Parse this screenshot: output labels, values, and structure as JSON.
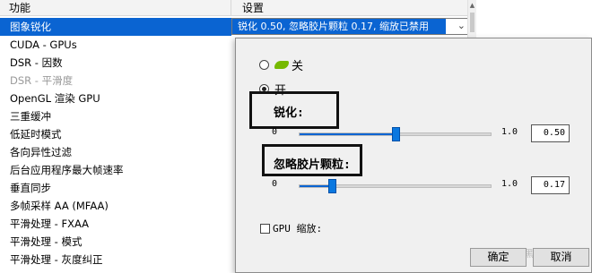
{
  "header": {
    "feature_col": "功能",
    "setting_col": "设置"
  },
  "features": [
    {
      "label": "图象锐化",
      "state": "selected"
    },
    {
      "label": "CUDA - GPUs",
      "state": "normal"
    },
    {
      "label": "DSR - 因数",
      "state": "normal"
    },
    {
      "label": "DSR - 平滑度",
      "state": "disabled"
    },
    {
      "label": "OpenGL 渲染 GPU",
      "state": "normal"
    },
    {
      "label": "三重缓冲",
      "state": "normal"
    },
    {
      "label": "低延时模式",
      "state": "normal"
    },
    {
      "label": "各向异性过滤",
      "state": "normal"
    },
    {
      "label": "后台应用程序最大帧速率",
      "state": "normal"
    },
    {
      "label": "垂直同步",
      "state": "normal"
    },
    {
      "label": "多帧采样 AA (MFAA)",
      "state": "normal"
    },
    {
      "label": "平滑处理 - FXAA",
      "state": "normal"
    },
    {
      "label": "平滑处理 - 模式",
      "state": "normal"
    },
    {
      "label": "平滑处理 - 灰度纠正",
      "state": "normal"
    }
  ],
  "current_value": "锐化 0.50, 忽略胶片颗粒 0.17, 缩放已禁用",
  "dialog": {
    "option_off": "关",
    "option_on": "开",
    "sharpen_label": "锐化:",
    "grain_label": "忽略胶片颗粒:",
    "sharpen": {
      "min": "0",
      "max": "1.0",
      "value": "0.50",
      "level": 0.5
    },
    "grain": {
      "min": "0",
      "max": "1.0",
      "value": "0.17",
      "level": 0.17
    },
    "gpu_scaling_label": "GPU 缩放:",
    "ok_label": "确定",
    "cancel_label": "取消",
    "watermark": "小黑盒"
  },
  "colors": {
    "selection": "#0a64d2",
    "nvidia_green": "#76b900"
  }
}
